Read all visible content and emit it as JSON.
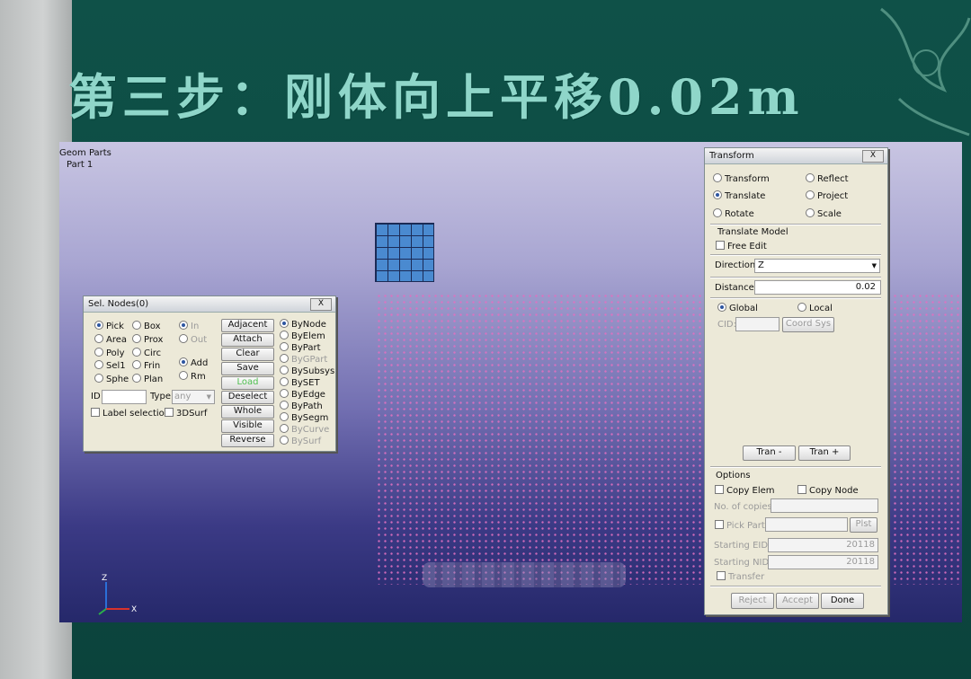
{
  "slide": {
    "title": "第三步：刚体向上平移0.02m"
  },
  "tree": {
    "root": "Geom Parts",
    "part": "Part 1"
  },
  "axis": {
    "z": "Z",
    "x": "X"
  },
  "sel": {
    "title": "Sel. Nodes(0)",
    "close": "X",
    "modes": [
      "Pick",
      "Area",
      "Poly",
      "Sel1",
      "Sphe"
    ],
    "modes2": [
      "Box",
      "Prox",
      "Circ",
      "Frin",
      "Plan"
    ],
    "in": "In",
    "out": "Out",
    "add": "Add",
    "rm": "Rm",
    "id_label": "ID",
    "type_label": "Type",
    "type_value": "any",
    "label_selection": "Label selection",
    "surf3d": "3DSurf",
    "buttons": [
      "Adjacent",
      "Attach",
      "Clear",
      "Save",
      "Load",
      "Deselect",
      "Whole",
      "Visible",
      "Reverse"
    ],
    "by": [
      "ByNode",
      "ByElem",
      "ByPart",
      "ByGPart",
      "BySubsys",
      "BySET",
      "ByEdge",
      "ByPath",
      "BySegm",
      "ByCurve",
      "BySurf"
    ]
  },
  "transform": {
    "title": "Transform",
    "close": "X",
    "ops": [
      "Transform",
      "Reflect",
      "Translate",
      "Project",
      "Rotate",
      "Scale"
    ],
    "translate_model": "Translate Model",
    "free_edit": "Free Edit",
    "direction_label": "Direction:",
    "direction_value": "Z",
    "distance_label": "Distance:",
    "distance_value": "0.02",
    "global": "Global",
    "local": "Local",
    "cid_label": "CID:",
    "coord_sys": "Coord Sys",
    "tran_minus": "Tran -",
    "tran_plus": "Tran +",
    "options": "Options",
    "copy_elem": "Copy Elem",
    "copy_node": "Copy Node",
    "no_copies": "No. of copies:",
    "pick_part": "Pick Part",
    "plst": "Plst",
    "starting_eid": "Starting EID:",
    "starting_eid_value": "20118",
    "starting_nid": "Starting NID:",
    "starting_nid_value": "20118",
    "transfer": "Transfer",
    "reject": "Reject",
    "accept": "Accept",
    "done": "Done"
  }
}
